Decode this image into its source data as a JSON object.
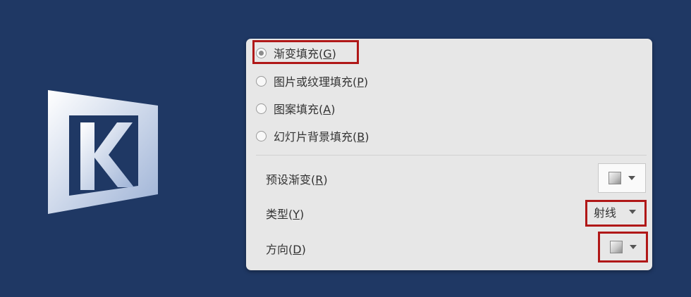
{
  "fill_options": [
    {
      "text": "渐变填充(",
      "key": "G",
      "close": ")",
      "checked": true
    },
    {
      "text": "图片或纹理填充(",
      "key": "P",
      "close": ")",
      "checked": false
    },
    {
      "text": "图案填充(",
      "key": "A",
      "close": ")",
      "checked": false
    },
    {
      "text": "幻灯片背景填充(",
      "key": "B",
      "close": ")",
      "checked": false
    }
  ],
  "gradient_settings": {
    "preset": {
      "text": "预设渐变(",
      "key": "R",
      "close": ")"
    },
    "type": {
      "text": "类型(",
      "key": "Y",
      "close": ")",
      "value": "射线"
    },
    "direction": {
      "text": "方向(",
      "key": "D",
      "close": ")"
    }
  },
  "colors": {
    "background": "#1f3864",
    "panel": "#e7e7e7",
    "highlight": "#b01818"
  }
}
